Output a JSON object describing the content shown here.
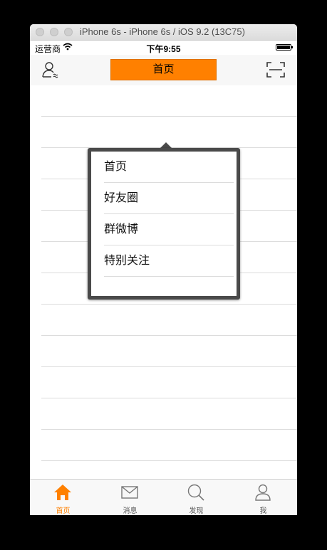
{
  "window": {
    "title": "iPhone 6s - iPhone 6s / iOS 9.2 (13C75)"
  },
  "status_bar": {
    "carrier": "运营商",
    "time": "下午9:55"
  },
  "nav": {
    "left_icon": "add-friend-icon",
    "title": "首页",
    "right_icon": "scan-icon"
  },
  "popup_menu": {
    "items": [
      {
        "label": "首页"
      },
      {
        "label": "好友圈"
      },
      {
        "label": "群微博"
      },
      {
        "label": "特别关注"
      }
    ]
  },
  "tabbar": {
    "active_color": "#ff8000",
    "items": [
      {
        "label": "首页",
        "icon": "home-icon",
        "active": true
      },
      {
        "label": "消息",
        "icon": "envelope-icon",
        "active": false
      },
      {
        "label": "发现",
        "icon": "search-icon",
        "active": false
      },
      {
        "label": "我",
        "icon": "person-icon",
        "active": false
      }
    ]
  }
}
